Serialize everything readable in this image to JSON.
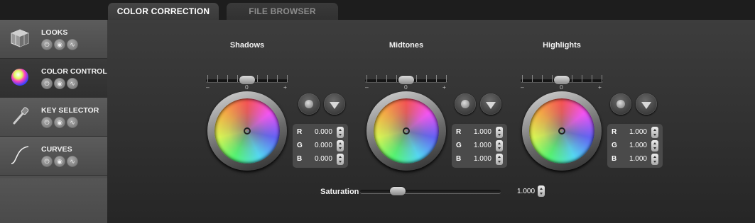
{
  "tabs": {
    "active": "COLOR CORRECTION",
    "inactive": "FILE BROWSER"
  },
  "sidebar": {
    "items": [
      {
        "label": "LOOKS",
        "icon": "cube-icon"
      },
      {
        "label": "COLOR CONTROL",
        "icon": "color-ball-icon"
      },
      {
        "label": "KEY SELECTOR",
        "icon": "eyedropper-icon"
      },
      {
        "label": "CURVES",
        "icon": "curve-icon"
      }
    ],
    "selected": "COLOR CONTROL"
  },
  "sections": [
    {
      "title": "Shadows",
      "slider_center": "0",
      "minus": "–",
      "plus": "+",
      "r": "0.000",
      "g": "0.000",
      "b": "0.000"
    },
    {
      "title": "Midtones",
      "slider_center": "0",
      "minus": "–",
      "plus": "+",
      "r": "1.000",
      "g": "1.000",
      "b": "1.000"
    },
    {
      "title": "Highlights",
      "slider_center": "0",
      "minus": "–",
      "plus": "+",
      "r": "1.000",
      "g": "1.000",
      "b": "1.000"
    }
  ],
  "channels": {
    "r": "R",
    "g": "G",
    "b": "B"
  },
  "saturation": {
    "label": "Saturation",
    "value": "1.000",
    "position": 0.27
  }
}
